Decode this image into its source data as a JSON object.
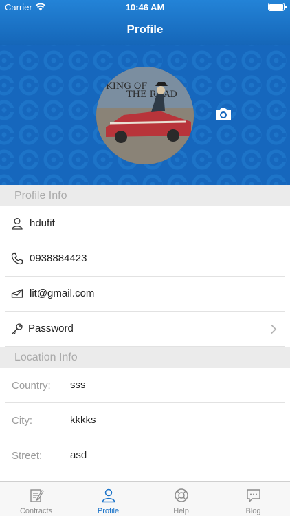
{
  "status_bar": {
    "carrier": "Carrier",
    "time": "10:46 AM"
  },
  "nav": {
    "title": "Profile"
  },
  "profile_header": {
    "avatar_image_text": "KING OF THE ROAD",
    "camera_icon": "camera-icon"
  },
  "profile_info": {
    "header": "Profile Info",
    "name": "hdufif",
    "phone": "0938884423",
    "email": "lit@gmail.com",
    "password_label": "Password"
  },
  "location_info": {
    "header": "Location Info",
    "rows": [
      {
        "label": "Country:",
        "value": "sss"
      },
      {
        "label": "City:",
        "value": "kkkks"
      },
      {
        "label": "Street:",
        "value": "asd"
      }
    ]
  },
  "tabbar": {
    "tabs": [
      {
        "label": "Contracts",
        "icon": "contract-icon"
      },
      {
        "label": "Profile",
        "icon": "profile-icon",
        "active": true
      },
      {
        "label": "Help",
        "icon": "lifebuoy-icon"
      },
      {
        "label": "Blog",
        "icon": "chat-icon"
      }
    ]
  },
  "colors": {
    "accent": "#1a73c9",
    "banner": "#1667bd",
    "section_bg": "#ebebeb"
  }
}
